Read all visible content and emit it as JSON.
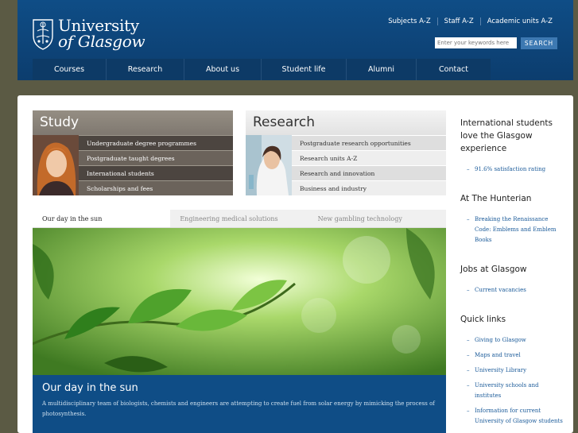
{
  "header": {
    "logo": {
      "line1": "University",
      "line2": "of Glasgow"
    },
    "top_links": [
      "Subjects A-Z",
      "Staff A-Z",
      "Academic units A-Z"
    ],
    "search": {
      "placeholder": "Enter your keywords here",
      "button": "SEARCH"
    },
    "nav": [
      "Courses",
      "Research",
      "About us",
      "Student life",
      "Alumni",
      "Contact"
    ]
  },
  "study": {
    "title": "Study",
    "links": [
      "Undergraduate degree programmes",
      "Postgraduate taught degrees",
      "International students",
      "Scholarships and fees"
    ]
  },
  "research": {
    "title": "Research",
    "links": [
      "Postgraduate research opportunities",
      "Research units A-Z",
      "Research and innovation",
      "Business and industry"
    ]
  },
  "feature": {
    "tabs": [
      "Our day in the sun",
      "Engineering medical solutions",
      "New gambling technology"
    ],
    "active_tab": 0,
    "caption_title": "Our day in the sun",
    "caption_text": "A multidisciplinary team of biologists, chemists and engineers are attempting to create fuel from solar energy by mimicking the process of photosynthesis."
  },
  "sidebar": {
    "sections": [
      {
        "heading": "International students love the Glasgow experience",
        "links": [
          "91.6% satisfaction rating"
        ]
      },
      {
        "heading": "At The Hunterian",
        "links": [
          "Breaking the Renaissance Code: Emblems and Emblem Books"
        ]
      },
      {
        "heading": "Jobs at Glasgow",
        "links": [
          "Current vacancies"
        ]
      },
      {
        "heading": "Quick links",
        "links": [
          "Giving to Glasgow",
          "Maps and travel",
          "University Library",
          "University schools and institutes",
          "Information for current University of Glasgow students"
        ]
      }
    ]
  },
  "colors": {
    "header_blue": "#0f4d86",
    "nav_blue": "#0d3a66",
    "link_blue": "#1a5a99",
    "page_bg": "#5b5a44"
  }
}
